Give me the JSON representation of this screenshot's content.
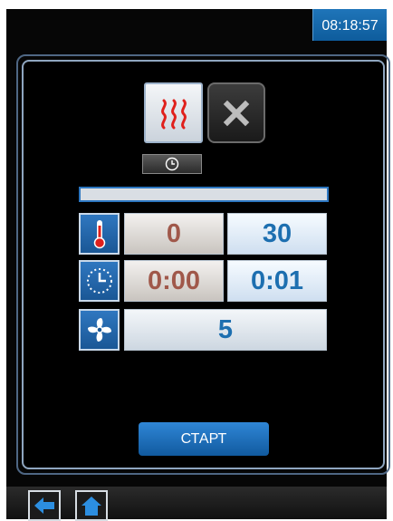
{
  "status_bar": {
    "clock": "08:18:57"
  },
  "mode_buttons": {
    "heat_icon": "steam-heat-icon",
    "cancel_icon": "close-icon",
    "timer_icon": "clock-icon"
  },
  "progress": {
    "fraction": 0
  },
  "rows": {
    "temperature": {
      "icon": "thermometer-icon",
      "actual": "0",
      "set": "30"
    },
    "time": {
      "icon": "timer-icon",
      "actual": "0:00",
      "set": "0:01"
    },
    "fan": {
      "icon": "fan-icon",
      "value": "5"
    }
  },
  "start_button": {
    "label": "СТАРТ"
  },
  "nav": {
    "back_icon": "back-arrow-icon",
    "home_icon": "home-icon"
  },
  "colors": {
    "accent": "#1d6fb0",
    "actual_text": "#a0584a",
    "heat_red": "#e0201c"
  }
}
